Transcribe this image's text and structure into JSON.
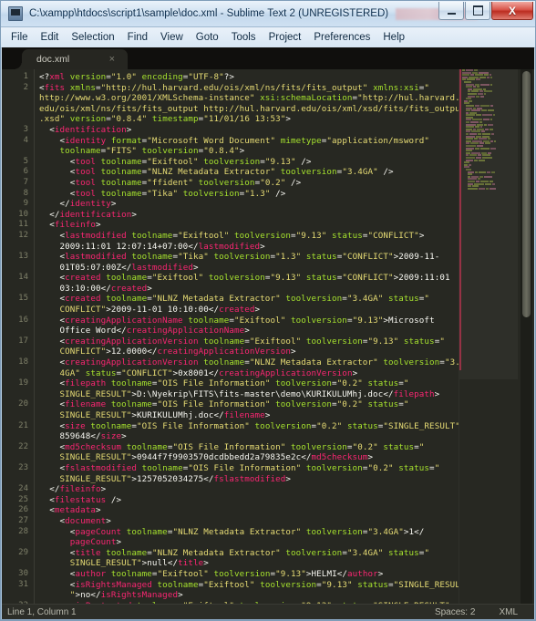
{
  "window": {
    "title": "C:\\xampp\\htdocs\\script1\\sample\\doc.xml - Sublime Text 2 (UNREGISTERED)",
    "icon": "sublime-text-icon",
    "buttons": {
      "minimize": "–",
      "maximize": "❐",
      "close": "X"
    },
    "accent_close": "#bb2c20",
    "titlebar_text_color": "#0b2d4d"
  },
  "menubar": {
    "items": [
      "File",
      "Edit",
      "Selection",
      "Find",
      "View",
      "Goto",
      "Tools",
      "Project",
      "Preferences",
      "Help"
    ]
  },
  "tabs": [
    {
      "label": "doc.xml",
      "close": "×",
      "active": true
    }
  ],
  "editor": {
    "theme_bg": "#272822",
    "gutter_color": "#7f8069",
    "lines": [
      {
        "num": "1",
        "html": "<span class=\"tagpunc\">&lt;?</span><span class=\"decl\">xml</span><span class=\"attr\"> version</span><span class=\"tagpunc\">=</span><span class=\"str\">\"1.0\"</span><span class=\"attr\"> encoding</span><span class=\"tagpunc\">=</span><span class=\"str\">\"UTF-8\"</span><span class=\"tagpunc\">?&gt;</span>"
      },
      {
        "num": "2",
        "html": "<span class=\"tagpunc\">&lt;</span><span class=\"tagname\">fits</span><span class=\"attr\"> xmlns</span><span class=\"tagpunc\">=</span><span class=\"str\">\"http://hul.harvard.edu/ois/xml/ns/fits/fits_output\"</span><span class=\"attr\"> xmlns:xsi</span><span class=\"tagpunc\">=</span><span class=\"str\">\"</span>"
      },
      {
        "num": "",
        "html": "<span class=\"str\">http://www.w3.org/2001/XMLSchema-instance\"</span><span class=\"attr\"> xsi:schemaLocation</span><span class=\"tagpunc\">=</span><span class=\"str\">\"http://hul.harvard.</span>"
      },
      {
        "num": "",
        "html": "<span class=\"str\">edu/ois/xml/ns/fits/fits_output http://hul.harvard.edu/ois/xml/xsd/fits/fits_output</span>"
      },
      {
        "num": "",
        "html": "<span class=\"str\">.xsd\"</span><span class=\"attr\"> version</span><span class=\"tagpunc\">=</span><span class=\"str\">\"0.8.4\"</span><span class=\"attr\"> timestamp</span><span class=\"tagpunc\">=</span><span class=\"str\">\"11/01/16 13:53\"</span><span class=\"tagpunc\">&gt;</span>"
      },
      {
        "num": "3",
        "html": "  <span class=\"tagpunc\">&lt;</span><span class=\"tagname\">identification</span><span class=\"tagpunc\">&gt;</span>"
      },
      {
        "num": "4",
        "html": "    <span class=\"tagpunc\">&lt;</span><span class=\"tagname\">identity</span><span class=\"attr\"> format</span><span class=\"tagpunc\">=</span><span class=\"str\">\"Microsoft Word Document\"</span><span class=\"attr\"> mimetype</span><span class=\"tagpunc\">=</span><span class=\"str\">\"application/msword\"</span>"
      },
      {
        "num": "",
        "html": "    <span class=\"attr\">toolname</span><span class=\"tagpunc\">=</span><span class=\"str\">\"FITS\"</span><span class=\"attr\"> toolversion</span><span class=\"tagpunc\">=</span><span class=\"str\">\"0.8.4\"</span><span class=\"tagpunc\">&gt;</span>"
      },
      {
        "num": "5",
        "html": "      <span class=\"tagpunc\">&lt;</span><span class=\"tagname\">tool</span><span class=\"attr\"> toolname</span><span class=\"tagpunc\">=</span><span class=\"str\">\"Exiftool\"</span><span class=\"attr\"> toolversion</span><span class=\"tagpunc\">=</span><span class=\"str\">\"9.13\"</span><span class=\"tagpunc\"> /&gt;</span>"
      },
      {
        "num": "6",
        "html": "      <span class=\"tagpunc\">&lt;</span><span class=\"tagname\">tool</span><span class=\"attr\"> toolname</span><span class=\"tagpunc\">=</span><span class=\"str\">\"NLNZ Metadata Extractor\"</span><span class=\"attr\"> toolversion</span><span class=\"tagpunc\">=</span><span class=\"str\">\"3.4GA\"</span><span class=\"tagpunc\"> /&gt;</span>"
      },
      {
        "num": "7",
        "html": "      <span class=\"tagpunc\">&lt;</span><span class=\"tagname\">tool</span><span class=\"attr\"> toolname</span><span class=\"tagpunc\">=</span><span class=\"str\">\"ffident\"</span><span class=\"attr\"> toolversion</span><span class=\"tagpunc\">=</span><span class=\"str\">\"0.2\"</span><span class=\"tagpunc\"> /&gt;</span>"
      },
      {
        "num": "8",
        "html": "      <span class=\"tagpunc\">&lt;</span><span class=\"tagname\">tool</span><span class=\"attr\"> toolname</span><span class=\"tagpunc\">=</span><span class=\"str\">\"Tika\"</span><span class=\"attr\"> toolversion</span><span class=\"tagpunc\">=</span><span class=\"str\">\"1.3\"</span><span class=\"tagpunc\"> /&gt;</span>"
      },
      {
        "num": "9",
        "html": "    <span class=\"tagpunc\">&lt;/</span><span class=\"tagname\">identity</span><span class=\"tagpunc\">&gt;</span>"
      },
      {
        "num": "10",
        "html": "  <span class=\"tagpunc\">&lt;/</span><span class=\"tagname\">identification</span><span class=\"tagpunc\">&gt;</span>"
      },
      {
        "num": "11",
        "html": "  <span class=\"tagpunc\">&lt;</span><span class=\"tagname\">fileinfo</span><span class=\"tagpunc\">&gt;</span>"
      },
      {
        "num": "12",
        "html": "    <span class=\"tagpunc\">&lt;</span><span class=\"tagname\">lastmodified</span><span class=\"attr\"> toolname</span><span class=\"tagpunc\">=</span><span class=\"str\">\"Exiftool\"</span><span class=\"attr\"> toolversion</span><span class=\"tagpunc\">=</span><span class=\"str\">\"9.13\"</span><span class=\"attr\"> status</span><span class=\"tagpunc\">=</span><span class=\"str\">\"CONFLICT\"</span><span class=\"tagpunc\">&gt;</span>"
      },
      {
        "num": "",
        "html": "    <span class=\"txt\">2009:11:01 12:07:14+07:00</span><span class=\"tagpunc\">&lt;/</span><span class=\"tagname\">lastmodified</span><span class=\"tagpunc\">&gt;</span>"
      },
      {
        "num": "13",
        "html": "    <span class=\"tagpunc\">&lt;</span><span class=\"tagname\">lastmodified</span><span class=\"attr\"> toolname</span><span class=\"tagpunc\">=</span><span class=\"str\">\"Tika\"</span><span class=\"attr\"> toolversion</span><span class=\"tagpunc\">=</span><span class=\"str\">\"1.3\"</span><span class=\"attr\"> status</span><span class=\"tagpunc\">=</span><span class=\"str\">\"CONFLICT\"</span><span class=\"tagpunc\">&gt;</span><span class=\"txt\">2009-11-</span>"
      },
      {
        "num": "",
        "html": "    <span class=\"txt\">01T05:07:00Z</span><span class=\"tagpunc\">&lt;/</span><span class=\"tagname\">lastmodified</span><span class=\"tagpunc\">&gt;</span>"
      },
      {
        "num": "14",
        "html": "    <span class=\"tagpunc\">&lt;</span><span class=\"tagname\">created</span><span class=\"attr\"> toolname</span><span class=\"tagpunc\">=</span><span class=\"str\">\"Exiftool\"</span><span class=\"attr\"> toolversion</span><span class=\"tagpunc\">=</span><span class=\"str\">\"9.13\"</span><span class=\"attr\"> status</span><span class=\"tagpunc\">=</span><span class=\"str\">\"CONFLICT\"</span><span class=\"tagpunc\">&gt;</span><span class=\"txt\">2009:11:01</span>"
      },
      {
        "num": "",
        "html": "    <span class=\"txt\">03:10:00</span><span class=\"tagpunc\">&lt;/</span><span class=\"tagname\">created</span><span class=\"tagpunc\">&gt;</span>"
      },
      {
        "num": "15",
        "html": "    <span class=\"tagpunc\">&lt;</span><span class=\"tagname\">created</span><span class=\"attr\"> toolname</span><span class=\"tagpunc\">=</span><span class=\"str\">\"NLNZ Metadata Extractor\"</span><span class=\"attr\"> toolversion</span><span class=\"tagpunc\">=</span><span class=\"str\">\"3.4GA\"</span><span class=\"attr\"> status</span><span class=\"tagpunc\">=</span><span class=\"str\">\"</span>"
      },
      {
        "num": "",
        "html": "    <span class=\"str\">CONFLICT\"</span><span class=\"tagpunc\">&gt;</span><span class=\"txt\">2009-11-01 10:10:00</span><span class=\"tagpunc\">&lt;/</span><span class=\"tagname\">created</span><span class=\"tagpunc\">&gt;</span>"
      },
      {
        "num": "16",
        "html": "    <span class=\"tagpunc\">&lt;</span><span class=\"tagname\">creatingApplicationName</span><span class=\"attr\"> toolname</span><span class=\"tagpunc\">=</span><span class=\"str\">\"Exiftool\"</span><span class=\"attr\"> toolversion</span><span class=\"tagpunc\">=</span><span class=\"str\">\"9.13\"</span><span class=\"tagpunc\">&gt;</span><span class=\"txt\">Microsoft</span>"
      },
      {
        "num": "",
        "html": "    <span class=\"txt\">Office Word</span><span class=\"tagpunc\">&lt;/</span><span class=\"tagname\">creatingApplicationName</span><span class=\"tagpunc\">&gt;</span>"
      },
      {
        "num": "17",
        "html": "    <span class=\"tagpunc\">&lt;</span><span class=\"tagname\">creatingApplicationVersion</span><span class=\"attr\"> toolname</span><span class=\"tagpunc\">=</span><span class=\"str\">\"Exiftool\"</span><span class=\"attr\"> toolversion</span><span class=\"tagpunc\">=</span><span class=\"str\">\"9.13\"</span><span class=\"attr\"> status</span><span class=\"tagpunc\">=</span><span class=\"str\">\"</span>"
      },
      {
        "num": "",
        "html": "    <span class=\"str\">CONFLICT\"</span><span class=\"tagpunc\">&gt;</span><span class=\"txt\">12.0000</span><span class=\"tagpunc\">&lt;/</span><span class=\"tagname\">creatingApplicationVersion</span><span class=\"tagpunc\">&gt;</span>"
      },
      {
        "num": "18",
        "html": "    <span class=\"tagpunc\">&lt;</span><span class=\"tagname\">creatingApplicationVersion</span><span class=\"attr\"> toolname</span><span class=\"tagpunc\">=</span><span class=\"str\">\"NLNZ Metadata Extractor\"</span><span class=\"attr\"> toolversion</span><span class=\"tagpunc\">=</span><span class=\"str\">\"3.</span>"
      },
      {
        "num": "",
        "html": "    <span class=\"str\">4GA\"</span><span class=\"attr\"> status</span><span class=\"tagpunc\">=</span><span class=\"str\">\"CONFLICT\"</span><span class=\"tagpunc\">&gt;</span><span class=\"txt\">0x8001</span><span class=\"tagpunc\">&lt;/</span><span class=\"tagname\">creatingApplicationVersion</span><span class=\"tagpunc\">&gt;</span>"
      },
      {
        "num": "19",
        "html": "    <span class=\"tagpunc\">&lt;</span><span class=\"tagname\">filepath</span><span class=\"attr\"> toolname</span><span class=\"tagpunc\">=</span><span class=\"str\">\"OIS File Information\"</span><span class=\"attr\"> toolversion</span><span class=\"tagpunc\">=</span><span class=\"str\">\"0.2\"</span><span class=\"attr\"> status</span><span class=\"tagpunc\">=</span><span class=\"str\">\"</span>"
      },
      {
        "num": "",
        "html": "    <span class=\"str\">SINGLE_RESULT\"</span><span class=\"tagpunc\">&gt;</span><span class=\"txt\">D:\\Nyekrip\\FITS\\fits-master\\demo\\KURIKULUMhj.doc</span><span class=\"tagpunc\">&lt;/</span><span class=\"tagname\">filepath</span><span class=\"tagpunc\">&gt;</span>"
      },
      {
        "num": "20",
        "html": "    <span class=\"tagpunc\">&lt;</span><span class=\"tagname\">filename</span><span class=\"attr\"> toolname</span><span class=\"tagpunc\">=</span><span class=\"str\">\"OIS File Information\"</span><span class=\"attr\"> toolversion</span><span class=\"tagpunc\">=</span><span class=\"str\">\"0.2\"</span><span class=\"attr\"> status</span><span class=\"tagpunc\">=</span><span class=\"str\">\"</span>"
      },
      {
        "num": "",
        "html": "    <span class=\"str\">SINGLE_RESULT\"</span><span class=\"tagpunc\">&gt;</span><span class=\"txt\">KURIKULUMhj.doc</span><span class=\"tagpunc\">&lt;/</span><span class=\"tagname\">filename</span><span class=\"tagpunc\">&gt;</span>"
      },
      {
        "num": "21",
        "html": "    <span class=\"tagpunc\">&lt;</span><span class=\"tagname\">size</span><span class=\"attr\"> toolname</span><span class=\"tagpunc\">=</span><span class=\"str\">\"OIS File Information\"</span><span class=\"attr\"> toolversion</span><span class=\"tagpunc\">=</span><span class=\"str\">\"0.2\"</span><span class=\"attr\"> status</span><span class=\"tagpunc\">=</span><span class=\"str\">\"SINGLE_RESULT\"</span><span class=\"tagpunc\">&gt;</span>"
      },
      {
        "num": "",
        "html": "    <span class=\"txt\">859648</span><span class=\"tagpunc\">&lt;/</span><span class=\"tagname\">size</span><span class=\"tagpunc\">&gt;</span>"
      },
      {
        "num": "22",
        "html": "    <span class=\"tagpunc\">&lt;</span><span class=\"tagname\">md5checksum</span><span class=\"attr\"> toolname</span><span class=\"tagpunc\">=</span><span class=\"str\">\"OIS File Information\"</span><span class=\"attr\"> toolversion</span><span class=\"tagpunc\">=</span><span class=\"str\">\"0.2\"</span><span class=\"attr\"> status</span><span class=\"tagpunc\">=</span><span class=\"str\">\"</span>"
      },
      {
        "num": "",
        "html": "    <span class=\"str\">SINGLE_RESULT\"</span><span class=\"tagpunc\">&gt;</span><span class=\"txt\">0944f7f9903570dcdbbedd2a79835e2c</span><span class=\"tagpunc\">&lt;/</span><span class=\"tagname\">md5checksum</span><span class=\"tagpunc\">&gt;</span>"
      },
      {
        "num": "23",
        "html": "    <span class=\"tagpunc\">&lt;</span><span class=\"tagname\">fslastmodified</span><span class=\"attr\"> toolname</span><span class=\"tagpunc\">=</span><span class=\"str\">\"OIS File Information\"</span><span class=\"attr\"> toolversion</span><span class=\"tagpunc\">=</span><span class=\"str\">\"0.2\"</span><span class=\"attr\"> status</span><span class=\"tagpunc\">=</span><span class=\"str\">\"</span>"
      },
      {
        "num": "",
        "html": "    <span class=\"str\">SINGLE_RESULT\"</span><span class=\"tagpunc\">&gt;</span><span class=\"txt\">1257052034275</span><span class=\"tagpunc\">&lt;/</span><span class=\"tagname\">fslastmodified</span><span class=\"tagpunc\">&gt;</span>"
      },
      {
        "num": "24",
        "html": "  <span class=\"tagpunc\">&lt;/</span><span class=\"tagname\">fileinfo</span><span class=\"tagpunc\">&gt;</span>"
      },
      {
        "num": "25",
        "html": "  <span class=\"tagpunc\">&lt;</span><span class=\"tagname\">filestatus</span><span class=\"tagpunc\"> /&gt;</span>"
      },
      {
        "num": "26",
        "html": "  <span class=\"tagpunc\">&lt;</span><span class=\"tagname\">metadata</span><span class=\"tagpunc\">&gt;</span>"
      },
      {
        "num": "27",
        "html": "    <span class=\"tagpunc\">&lt;</span><span class=\"tagname\">document</span><span class=\"tagpunc\">&gt;</span>"
      },
      {
        "num": "28",
        "html": "      <span class=\"tagpunc\">&lt;</span><span class=\"tagname\">pageCount</span><span class=\"attr\"> toolname</span><span class=\"tagpunc\">=</span><span class=\"str\">\"NLNZ Metadata Extractor\"</span><span class=\"attr\"> toolversion</span><span class=\"tagpunc\">=</span><span class=\"str\">\"3.4GA\"</span><span class=\"tagpunc\">&gt;</span><span class=\"txt\">1</span><span class=\"tagpunc\">&lt;/</span>"
      },
      {
        "num": "",
        "html": "      <span class=\"tagname\">pageCount</span><span class=\"tagpunc\">&gt;</span>"
      },
      {
        "num": "29",
        "html": "      <span class=\"tagpunc\">&lt;</span><span class=\"tagname\">title</span><span class=\"attr\"> toolname</span><span class=\"tagpunc\">=</span><span class=\"str\">\"NLNZ Metadata Extractor\"</span><span class=\"attr\"> toolversion</span><span class=\"tagpunc\">=</span><span class=\"str\">\"3.4GA\"</span><span class=\"attr\"> status</span><span class=\"tagpunc\">=</span><span class=\"str\">\"</span>"
      },
      {
        "num": "",
        "html": "      <span class=\"str\">SINGLE_RESULT\"</span><span class=\"tagpunc\">&gt;</span><span class=\"txt\">null</span><span class=\"tagpunc\">&lt;/</span><span class=\"tagname\">title</span><span class=\"tagpunc\">&gt;</span>"
      },
      {
        "num": "30",
        "html": "      <span class=\"tagpunc\">&lt;</span><span class=\"tagname\">author</span><span class=\"attr\"> toolname</span><span class=\"tagpunc\">=</span><span class=\"str\">\"Exiftool\"</span><span class=\"attr\"> toolversion</span><span class=\"tagpunc\">=</span><span class=\"str\">\"9.13\"</span><span class=\"tagpunc\">&gt;</span><span class=\"txt\">HELMI</span><span class=\"tagpunc\">&lt;/</span><span class=\"tagname\">author</span><span class=\"tagpunc\">&gt;</span>"
      },
      {
        "num": "31",
        "html": "      <span class=\"tagpunc\">&lt;</span><span class=\"tagname\">isRightsManaged</span><span class=\"attr\"> toolname</span><span class=\"tagpunc\">=</span><span class=\"str\">\"Exiftool\"</span><span class=\"attr\"> toolversion</span><span class=\"tagpunc\">=</span><span class=\"str\">\"9.13\"</span><span class=\"attr\"> status</span><span class=\"tagpunc\">=</span><span class=\"str\">\"SINGLE_RESULT</span>"
      },
      {
        "num": "",
        "html": "      <span class=\"str\">\"</span><span class=\"tagpunc\">&gt;</span><span class=\"txt\">no</span><span class=\"tagpunc\">&lt;/</span><span class=\"tagname\">isRightsManaged</span><span class=\"tagpunc\">&gt;</span>"
      },
      {
        "num": "32",
        "html": "      <span class=\"tagpunc\">&lt;</span><span class=\"tagname\">isProtected</span><span class=\"attr\"> toolname</span><span class=\"tagpunc\">=</span><span class=\"str\">\"Exiftool\"</span><span class=\"attr\"> toolversion</span><span class=\"tagpunc\">=</span><span class=\"str\">\"9.13\"</span><span class=\"attr\"> status</span><span class=\"tagpunc\">=</span><span class=\"str\">\"SINGLE_RESULT\"</span><span class=\"tagpunc\">&gt;</span>"
      }
    ]
  },
  "statusbar": {
    "position": "Line 1, Column 1",
    "indent": "Spaces: 2",
    "syntax": "XML"
  }
}
